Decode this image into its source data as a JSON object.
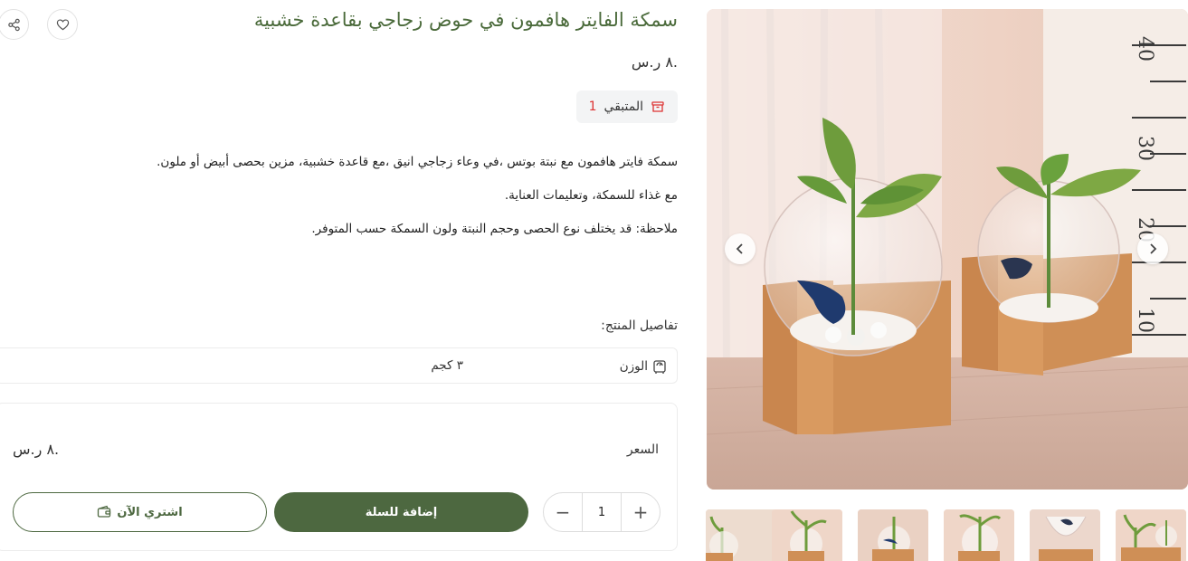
{
  "product": {
    "title": "سمكة الفايتر هافمون في حوض زجاجي بقاعدة خشبية",
    "price": ".٨ ر.س",
    "stock_label": "المتبقي",
    "stock_count": "1",
    "description": [
      "سمكة فايتر هافمون مع نبتة بوتس ،في وعاء زجاجي انيق ،مع قاعدة خشبية، مزين بحصى أبيض أو ملون.",
      "مع غذاء للسمكة، وتعليمات العناية.",
      "ملاحظة: قد يختلف نوع الحصى وحجم النبتة ولون السمكة حسب المتوفر."
    ],
    "details_title": "تفاصيل المنتج:",
    "details": {
      "label": "الوزن",
      "value": "٣ كجم"
    }
  },
  "buy_box": {
    "price_label": "السعر",
    "price_value": ".٨ ر.س",
    "quantity": "1",
    "plus": "+",
    "minus": "−",
    "add_to_cart": "إضافة للسلة",
    "buy_now": "اشتري الآن"
  },
  "colors": {
    "accent": "#4d6840",
    "title": "#4a6a3a",
    "stock_number": "#dd3333"
  },
  "icons": [
    "share-icon",
    "heart-icon",
    "box-icon",
    "scale-icon",
    "wallet-icon",
    "chevron-left-icon",
    "chevron-right-icon"
  ]
}
